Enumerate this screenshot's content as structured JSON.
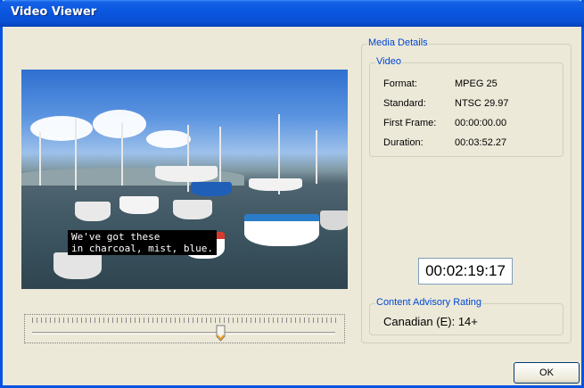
{
  "window": {
    "title": "Video Viewer"
  },
  "video": {
    "caption_line1": "We've got these",
    "caption_line2": "in charcoal, mist, blue."
  },
  "seek_slider": {
    "position_fraction": 0.62
  },
  "media_details": {
    "legend": "Media Details",
    "video_group": {
      "legend": "Video",
      "rows": [
        {
          "label": "Format:",
          "value": "MPEG 25"
        },
        {
          "label": "Standard:",
          "value": "NTSC 29.97"
        },
        {
          "label": "First Frame:",
          "value": "00:00:00.00"
        },
        {
          "label": "Duration:",
          "value": "00:03:52.27"
        }
      ]
    },
    "timecode": "00:02:19:17",
    "content_advisory": {
      "legend": "Content Advisory Rating",
      "value": "Canadian (E): 14+"
    }
  },
  "buttons": {
    "ok": "OK"
  },
  "colors": {
    "title_bar": "#0a53e0",
    "legend_text": "#0046d5",
    "dialog_bg": "#ece9d8"
  }
}
